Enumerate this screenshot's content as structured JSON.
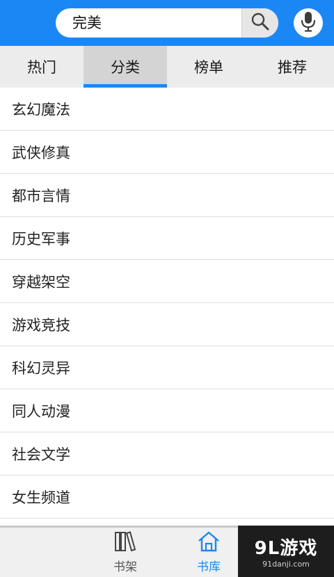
{
  "header": {
    "search_value": "完美",
    "search_icon": "magnifier-icon",
    "mic_icon": "microphone-icon",
    "accent_color": "#1b87f5"
  },
  "tabs": [
    {
      "label": "热门",
      "active": false
    },
    {
      "label": "分类",
      "active": true
    },
    {
      "label": "榜单",
      "active": false
    },
    {
      "label": "推荐",
      "active": false
    }
  ],
  "categories": [
    "玄幻魔法",
    "武侠修真",
    "都市言情",
    "历史军事",
    "穿越架空",
    "游戏竞技",
    "科幻灵异",
    "同人动漫",
    "社会文学",
    "女生频道"
  ],
  "bottom_nav": {
    "bookshelf": {
      "label": "书架",
      "icon": "books-icon"
    },
    "library": {
      "label": "书库",
      "icon": "home-icon",
      "active": true
    }
  },
  "watermark": {
    "logo": "9L游戏",
    "url": "91danji.com"
  }
}
